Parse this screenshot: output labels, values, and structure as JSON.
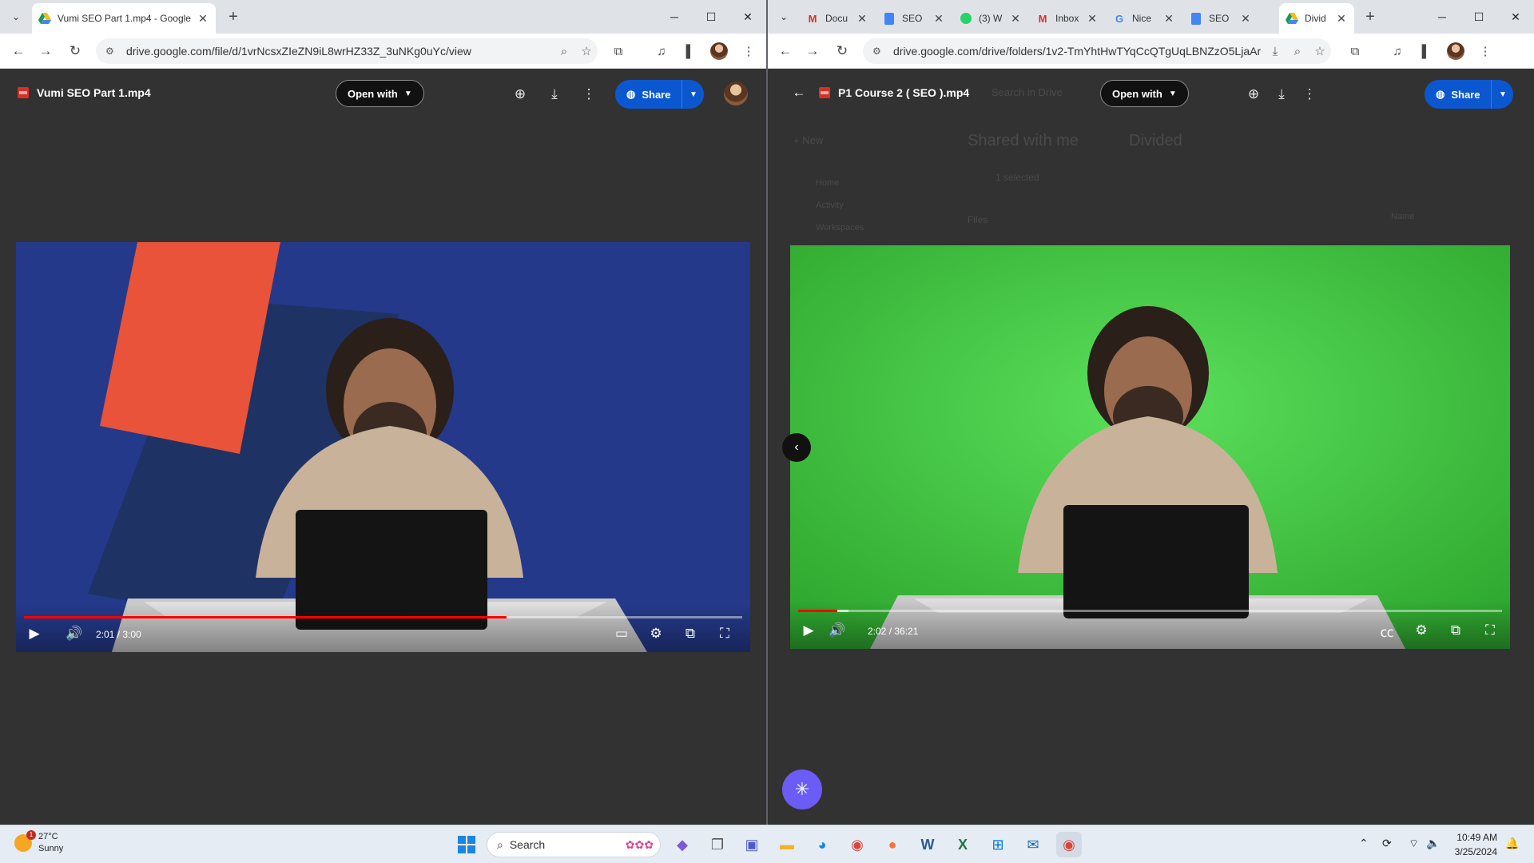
{
  "left": {
    "tab_title": "Vumi SEO Part 1.mp4 - Google",
    "url": "drive.google.com/file/d/1vrNcsxZIeZN9iL8wrHZ33Z_3uNKg0uYc/view",
    "file_title": "Vumi SEO Part 1.mp4",
    "open_with": "Open with",
    "share": "Share",
    "video": {
      "time": "2:01 / 3:00",
      "progress": 0.672,
      "background": "#24398a"
    }
  },
  "right": {
    "tabs": [
      {
        "label": "Docu",
        "icon": "gmail-icon"
      },
      {
        "label": "SEO",
        "icon": "docs-icon"
      },
      {
        "label": "(3) W",
        "icon": "whatsapp-icon"
      },
      {
        "label": "Inbox",
        "icon": "gmail-icon"
      },
      {
        "label": "Nice",
        "icon": "google-icon"
      },
      {
        "label": "SEO",
        "icon": "docs-icon"
      },
      {
        "label": "Divid",
        "icon": "drive-icon",
        "active": true
      }
    ],
    "url": "drive.google.com/drive/folders/1v2-TmYhtHwTYqCcQTgUqLBNZzO5LjaAr",
    "file_title": "P1 Course 2 ( SEO ).mp4",
    "open_with": "Open with",
    "share": "Share",
    "video": {
      "time": "2:02 / 36:21",
      "progress": 0.056,
      "background": "#3ec13e"
    },
    "background_drive": {
      "search": "Search in Drive",
      "new": "New",
      "breadcrumb_root": "Shared with me",
      "breadcrumb_folder": "Divided",
      "selected": "1 selected",
      "nav": [
        "Home",
        "Activity",
        "Workspaces"
      ],
      "files_label": "Files",
      "sort_label": "Name"
    }
  },
  "taskbar": {
    "weather_temp": "27°C",
    "weather_desc": "Sunny",
    "weather_badge": "1",
    "search_label": "Search",
    "time": "10:49 AM",
    "date": "3/25/2024"
  },
  "colors": {
    "drive_dark": "#323232",
    "share_blue": "#0b57d0",
    "progress_red": "#ff0000"
  }
}
